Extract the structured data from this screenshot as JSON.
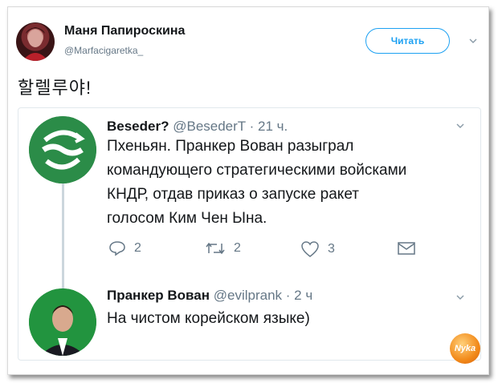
{
  "tweet": {
    "author_name": "Маня Папироскина",
    "author_handle": "@Marfacigaretka_",
    "follow_label": "Читать",
    "text": "할렐루야!"
  },
  "quoted": [
    {
      "name": "Beseder?",
      "handle": "@BesederT",
      "time": "· 21 ч.",
      "text_lines": [
        "Пхеньян. Пранкер Вован разыграл",
        "командующего стратегическими войсками",
        "КНДР, отдав приказ о запуске ракет",
        "голосом Ким Чен Ына."
      ],
      "actions": {
        "replies": "2",
        "retweets": "2",
        "likes": "3"
      }
    },
    {
      "name": "Пранкер Вован",
      "handle": "@evilprank",
      "time": "· 2 ч",
      "text": "На чистом корейском языке)"
    }
  ],
  "watermark": "Nyka",
  "icons": [
    "chevron-down-icon",
    "reply-icon",
    "retweet-icon",
    "like-icon",
    "dm-icon"
  ]
}
